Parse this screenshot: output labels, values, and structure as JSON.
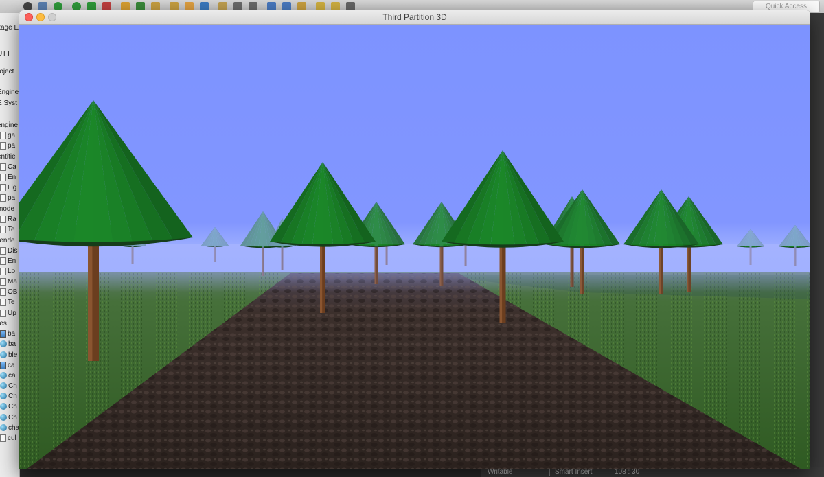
{
  "ide": {
    "quick_access": "Quick Access",
    "toolbar_icons": [
      "user-icon",
      "link-icon",
      "debug-icon",
      "run-icon",
      "coverage-icon",
      "external-tools-icon",
      "package-icon",
      "refresh-icon",
      "open-folder-icon",
      "open-file-icon",
      "edit-icon",
      "build-icon",
      "pencil-icon",
      "search-icon",
      "search2-icon",
      "tasks-icon",
      "annotation-icon",
      "forward-icon",
      "back-icon",
      "arrow-left-icon",
      "arrow-right-icon"
    ],
    "explorer_rows": [
      {
        "text": "kage E",
        "icon": "none"
      },
      {
        "text": "UTT",
        "icon": "none"
      },
      {
        "text": "roject",
        "icon": "none"
      },
      {
        "text": "Engine",
        "icon": "none"
      },
      {
        "text": "E Syst",
        "icon": "none"
      },
      {
        "text": "engine",
        "icon": "none"
      },
      {
        "text": "ga",
        "icon": "file"
      },
      {
        "text": "pa",
        "icon": "file"
      },
      {
        "text": "entitie",
        "icon": "none"
      },
      {
        "text": "Ca",
        "icon": "file"
      },
      {
        "text": "En",
        "icon": "file"
      },
      {
        "text": "Lig",
        "icon": "file"
      },
      {
        "text": "pa",
        "icon": "file"
      },
      {
        "text": "mode",
        "icon": "none"
      },
      {
        "text": "Ra",
        "icon": "file"
      },
      {
        "text": "Te",
        "icon": "file"
      },
      {
        "text": "rende",
        "icon": "none"
      },
      {
        "text": "Dis",
        "icon": "file"
      },
      {
        "text": "En",
        "icon": "file"
      },
      {
        "text": "Lo",
        "icon": "file"
      },
      {
        "text": "Ma",
        "icon": "file"
      },
      {
        "text": "OB",
        "icon": "file"
      },
      {
        "text": "Te",
        "icon": "file"
      },
      {
        "text": "Up",
        "icon": "file"
      },
      {
        "text": "res",
        "icon": "none"
      },
      {
        "text": "ba",
        "icon": "img"
      },
      {
        "text": "ba",
        "icon": "ball"
      },
      {
        "text": "ble",
        "icon": "ball"
      },
      {
        "text": "ca",
        "icon": "img"
      },
      {
        "text": "ca",
        "icon": "ball"
      },
      {
        "text": "Ch",
        "icon": "ball"
      },
      {
        "text": "Ch",
        "icon": "ball"
      },
      {
        "text": "Ch",
        "icon": "ball"
      },
      {
        "text": "Ch",
        "icon": "ball"
      },
      {
        "text": "cha",
        "icon": "ball"
      },
      {
        "text": "cul",
        "icon": "file"
      }
    ],
    "status_bar": {
      "writable": "Writable",
      "insert_mode": "Smart Insert",
      "position": "108 : 30"
    }
  },
  "window": {
    "title": "Third Partition 3D",
    "buttons": {
      "close": "close",
      "minimize": "minimize",
      "zoom": "zoom"
    }
  },
  "scene": {
    "colors": {
      "sky": "#7f95ff",
      "fog": "#9aa9ff",
      "grass": "#3f6a2a",
      "grass_dark": "#2c4f1e",
      "path": "#3a2f2a",
      "path_dark": "#2a211d",
      "foliage_light": "#3d9a3f",
      "foliage_dark": "#1d4f22",
      "trunk": "#6b3e1f"
    }
  }
}
